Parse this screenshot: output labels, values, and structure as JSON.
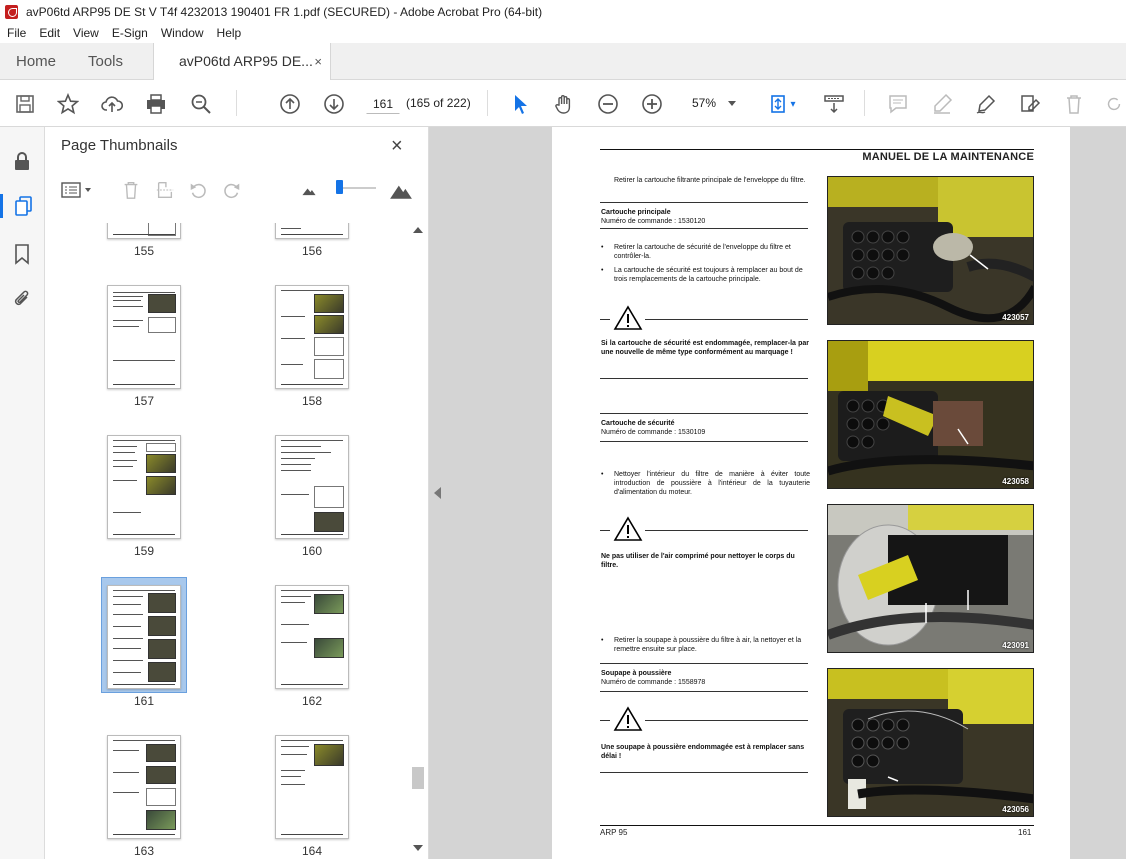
{
  "window": {
    "title": "avP06td ARP95 DE St V T4f 4232013 190401 FR 1.pdf (SECURED) - Adobe Acrobat Pro (64-bit)"
  },
  "menu": [
    "File",
    "Edit",
    "View",
    "E-Sign",
    "Window",
    "Help"
  ],
  "tabs": {
    "home": "Home",
    "tools": "Tools",
    "document": "avP06td ARP95 DE...",
    "close": "×"
  },
  "toolbar": {
    "page_number": "161",
    "page_count": "(165 of 222)",
    "zoom": "57%"
  },
  "panel": {
    "title": "Page Thumbnails",
    "close": "×",
    "thumbnails": [
      {
        "label": "155"
      },
      {
        "label": "156"
      },
      {
        "label": "157"
      },
      {
        "label": "158"
      },
      {
        "label": "159"
      },
      {
        "label": "160"
      },
      {
        "label": "161",
        "selected": true
      },
      {
        "label": "162"
      },
      {
        "label": "163"
      },
      {
        "label": "164"
      }
    ]
  },
  "page": {
    "heading": "MANUEL DE LA MAINTENANCE",
    "intro": "Retirer la cartouche filtrante principale de l'enveloppe du filtre.",
    "main_title": "Cartouche principale",
    "main_ref": "Numéro de commande : 1530120",
    "bullet1": "Retirer la cartouche de sécurité de l'enveloppe du filtre et contrôler-la.",
    "bullet2": "La cartouche de sécurité est toujours à remplacer au bout de trois remplacements de la cartouche principale.",
    "warn1": "Si la cartouche de sécurité est endommagée, remplacer-la par une nouvelle de même type conformément au marquage !",
    "safety_title": "Cartouche de sécurité",
    "safety_ref": "Numéro de commande : 1530109",
    "bullet3": "Nettoyer l'intérieur du filtre de manière à éviter toute introduction de poussière à l'intérieur de la tuyauterie d'alimentation du moteur.",
    "warn2": "Ne pas utiliser de l'air comprimé pour nettoyer le corps du filtre.",
    "bullet4": "Retirer la soupape à poussière du filtre à air, la nettoyer et la remettre ensuite sur place.",
    "valve_title": "Soupape à poussière",
    "valve_ref": "Numéro de commande : 1558978",
    "warn3": "Une soupape à poussière endommagée est à remplacer sans délai !",
    "photo1": "423057",
    "photo2": "423058",
    "photo3": "423091",
    "photo4": "423056",
    "footer_left": "ARP 95",
    "footer_right": "161"
  },
  "colors": {
    "accent": "#1473e6",
    "viewer_bg": "#d4d4d4",
    "selection": "#a8c8ec"
  }
}
